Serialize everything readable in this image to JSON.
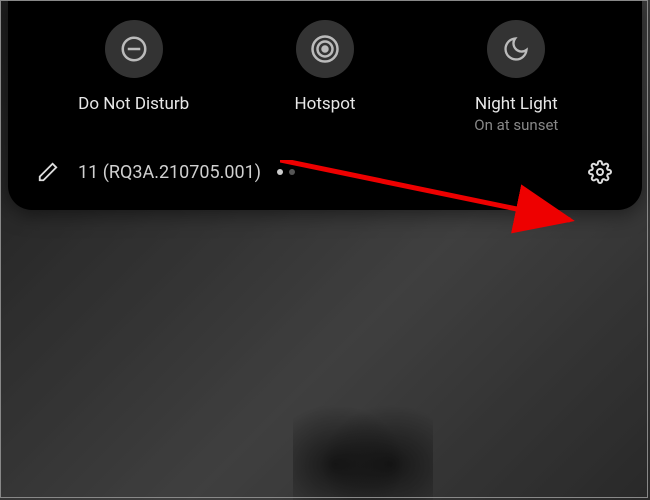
{
  "tiles": [
    {
      "label": "Do Not Disturb",
      "sublabel": "",
      "icon": "dnd"
    },
    {
      "label": "Hotspot",
      "sublabel": "",
      "icon": "hotspot"
    },
    {
      "label": "Night Light",
      "sublabel": "On at sunset",
      "icon": "nightlight"
    }
  ],
  "footer": {
    "version": "11 (RQ3A.210705.001)",
    "page_index": 0,
    "page_count": 2
  }
}
